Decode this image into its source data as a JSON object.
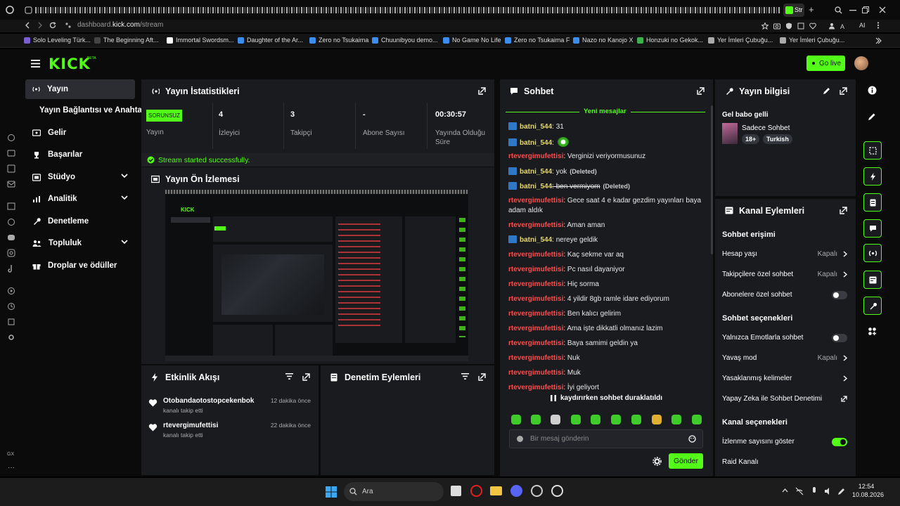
{
  "browser": {
    "active_tab_label": "Str",
    "url_prefix": "dashboard.",
    "url_domain": "kick.com",
    "url_path": "/stream",
    "bookmarks": [
      "Solo Leveling Türk...",
      "The Beginning Aft...",
      "Immortal Swordsm...",
      "Daughter of the Ar...",
      "Zero no Tsukaima",
      "Chuunibyou demo...",
      "No Game No Life",
      "Zero no Tsukaima F",
      "Nazo no Kanojo X",
      "Honzuki no Gekok...",
      "Yer İmleri Çubuğu...",
      "Yer İmleri Çubuğu..."
    ],
    "ai_label": "AI"
  },
  "header": {
    "logo": "KICK",
    "logo_sup": "BETA",
    "go_live": "Go live"
  },
  "sidebar": {
    "active": "Yayın",
    "sub": "Yayın Bağlantısı ve Anahtarı",
    "items": [
      {
        "label": "Gelir",
        "icon": "revenue-icon"
      },
      {
        "label": "Başarılar",
        "icon": "trophy-icon"
      },
      {
        "label": "Stüdyo",
        "icon": "studio-icon"
      },
      {
        "label": "Analitik",
        "icon": "analytics-icon"
      },
      {
        "label": "Denetleme",
        "icon": "wrench-icon"
      },
      {
        "label": "Topluluk",
        "icon": "community-icon"
      },
      {
        "label": "Droplar ve ödüller",
        "icon": "gift-icon"
      }
    ]
  },
  "stats": {
    "title": "Yayın İstatistikleri",
    "status_badge": "SORUNSUZ",
    "status_label": "Yayın",
    "viewers_value": "4",
    "viewers_label": "İzleyici",
    "followers_value": "3",
    "followers_label": "Takipçi",
    "subs_value": "-",
    "subs_label": "Abone Sayısı",
    "duration_value": "00:30:57",
    "duration_label": "Yayında Olduğu Süre",
    "success_msg": "Stream started successfully."
  },
  "preview": {
    "title": "Yayın Ön İzlemesi"
  },
  "activity": {
    "title": "Etkinlik Akışı",
    "events": [
      {
        "user": "Otobandaotostopcekenbok",
        "action": "kanalı takip etti",
        "time": "12 dakika önce"
      },
      {
        "user": "rtevergimufettisi",
        "action": "kanalı takip etti",
        "time": "22 dakika önce"
      }
    ]
  },
  "moderation": {
    "title": "Denetim Eylemleri"
  },
  "chat": {
    "title": "Sohbet",
    "new_messages": "Yeni mesajlar",
    "messages": [
      {
        "user": "batni_544",
        "badge": true,
        "text": ": 31"
      },
      {
        "user": "batni_544",
        "badge": true,
        "text": ":",
        "emote": true
      },
      {
        "user": "rtevergimufettisi",
        "text": ": Verginizi veriyormusunuz"
      },
      {
        "user": "batni_544",
        "badge": true,
        "text": ": yok",
        "deleted": "(Deleted)"
      },
      {
        "user": "batni_544",
        "badge": true,
        "text": ": ben vermiyom",
        "strike": true,
        "deleted": "(Deleted)"
      },
      {
        "user": "rtevergimufettisi",
        "text": ": Gece saat 4 e kadar gezdim yayınları baya",
        "cont": "adam aldık"
      },
      {
        "user": "rtevergimufettisi",
        "text": ": Aman aman"
      },
      {
        "user": "batni_544",
        "badge": true,
        "text": ": nereye geldik"
      },
      {
        "user": "rtevergimufettisi",
        "text": ": Kaç sekme var aq"
      },
      {
        "user": "rtevergimufettisi",
        "text": ": Pc nasıl dayaniyor"
      },
      {
        "user": "rtevergimufettisi",
        "text": ": Hiç sorma"
      },
      {
        "user": "rtevergimufettisi",
        "text": ": 4 yildir 8gb ramle idare ediyorum"
      },
      {
        "user": "rtevergimufettisi",
        "text": ": Ben kalıcı gelirim"
      },
      {
        "user": "rtevergimufettisi",
        "text": ": Ama işte dikkatli olmanız lazim"
      },
      {
        "user": "rtevergimufettisi",
        "text": ": Baya samimi geldin ya"
      },
      {
        "user": "rtevergimufettisi",
        "text": ": Nuk"
      },
      {
        "user": "rtevergimufettisi",
        "text": ": Muk"
      },
      {
        "user": "rtevergimufettisi",
        "text": ": İyi geliyort"
      }
    ],
    "paused": "kaydırırken sohbet duraklatıldı",
    "input_placeholder": "Bir mesaj gönderin",
    "send": "Gönder"
  },
  "info": {
    "title": "Yayın bilgisi",
    "stream_title": "Gel babo gelli",
    "category": "Sadece Sohbet",
    "tag_age": "18+",
    "tag_lang": "Turkish"
  },
  "channel_actions": {
    "title": "Kanal Eylemleri",
    "chat_access": "Sohbet erişimi",
    "account_age": "Hesap yaşı",
    "account_age_val": "Kapalı",
    "followers_only": "Takipçilere özel sohbet",
    "followers_only_val": "Kapalı",
    "subs_only": "Abonelere özel sohbet",
    "chat_options": "Sohbet seçenekleri",
    "emotes_only": "Yalnızca Emotlarla sohbet",
    "slow_mode": "Yavaş mod",
    "slow_mode_val": "Kapalı",
    "banned_words": "Yasaklanmış kelimeler",
    "ai_moderation": "Yapay Zeka ile Sohbet Denetimi",
    "channel_options": "Kanal seçenekleri",
    "show_viewers": "İzlenme sayısını göster",
    "raid": "Raid Kanalı"
  },
  "taskbar": {
    "search": "Ara",
    "time": "12:54",
    "date": "10.08.2026"
  },
  "colors": {
    "accent": "#53fc18",
    "panel": "#191b1f",
    "bg": "#0b0b0b",
    "user_red": "#ff4b4b",
    "user_yellow": "#e8d86a"
  }
}
